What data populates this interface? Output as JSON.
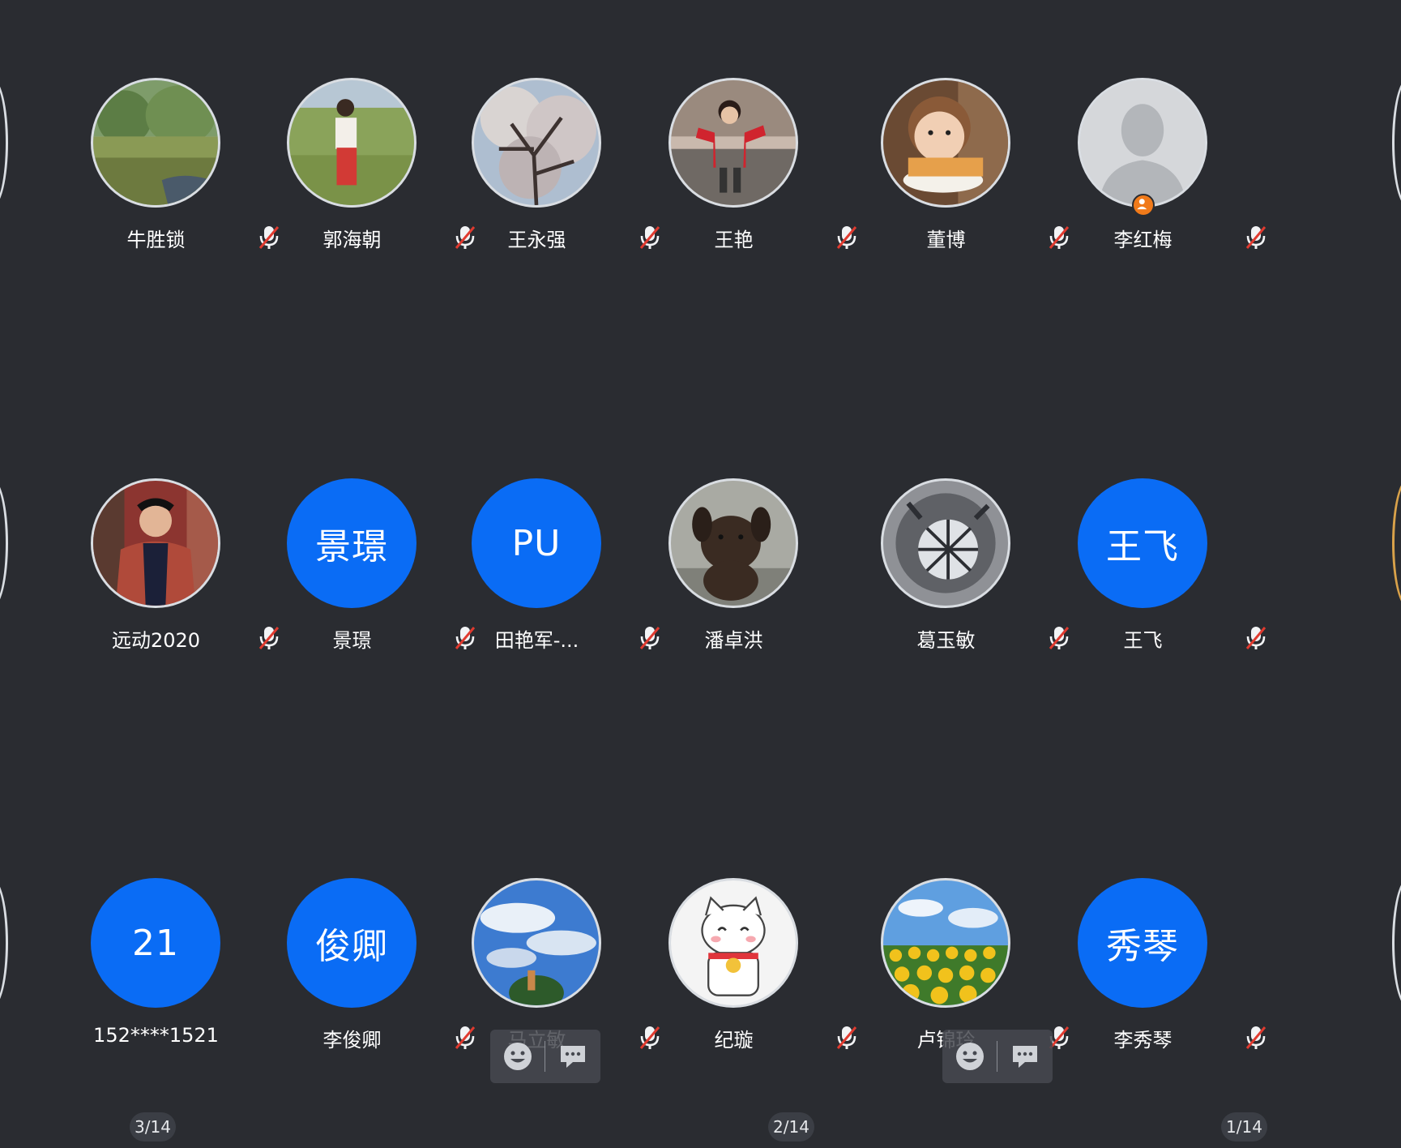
{
  "participants": [
    {
      "name": "牛胜锁",
      "avatar": "photo-meadow",
      "muted": true
    },
    {
      "name": "郭海朝",
      "avatar": "photo-woman-field",
      "muted": true
    },
    {
      "name": "王永强",
      "avatar": "photo-blossom-tree",
      "muted": true
    },
    {
      "name": "王艳",
      "avatar": "photo-girl-red-jacket",
      "muted": true
    },
    {
      "name": "董博",
      "avatar": "photo-toddler",
      "muted": true
    },
    {
      "name": "李红梅",
      "avatar": "default-silhouette",
      "host": true,
      "muted": true
    },
    {
      "name": "远动2020",
      "avatar": "photo-man-red-jacket",
      "muted": true
    },
    {
      "name": "景璟",
      "avatar_text": "景璟",
      "muted": true
    },
    {
      "name": "田艳军-...",
      "avatar_text": "PU",
      "muted": true
    },
    {
      "name": "潘卓洪",
      "avatar": "photo-puppy",
      "muted": false
    },
    {
      "name": "葛玉敏",
      "avatar": "photo-teapot",
      "muted": true
    },
    {
      "name": "王飞",
      "avatar_text": "王飞",
      "muted": true
    },
    {
      "name": "152****1521",
      "avatar_text": "21",
      "muted": false
    },
    {
      "name": "李俊卿",
      "avatar_text": "俊卿",
      "muted": true
    },
    {
      "name": "马立敏",
      "avatar": "photo-sky-clouds",
      "muted": true
    },
    {
      "name": "纪璇",
      "avatar": "photo-lucky-cat",
      "muted": true
    },
    {
      "name": "卢锦玲",
      "avatar": "photo-sunflowers",
      "muted": true
    },
    {
      "name": "李秀琴",
      "avatar_text": "秀琴",
      "muted": true
    }
  ],
  "page_indicators": [
    "3/14",
    "2/14",
    "1/14"
  ],
  "reaction_bars": [
    {
      "icons": [
        "smiley-icon",
        "chat-bubble-icon"
      ]
    },
    {
      "icons": [
        "smiley-icon",
        "chat-bubble-icon"
      ]
    }
  ],
  "colors": {
    "background": "#2a2c31",
    "text_avatar": "#0a6cf5",
    "mute_slash": "#e03a2f",
    "host_badge": "#f07a1a"
  }
}
